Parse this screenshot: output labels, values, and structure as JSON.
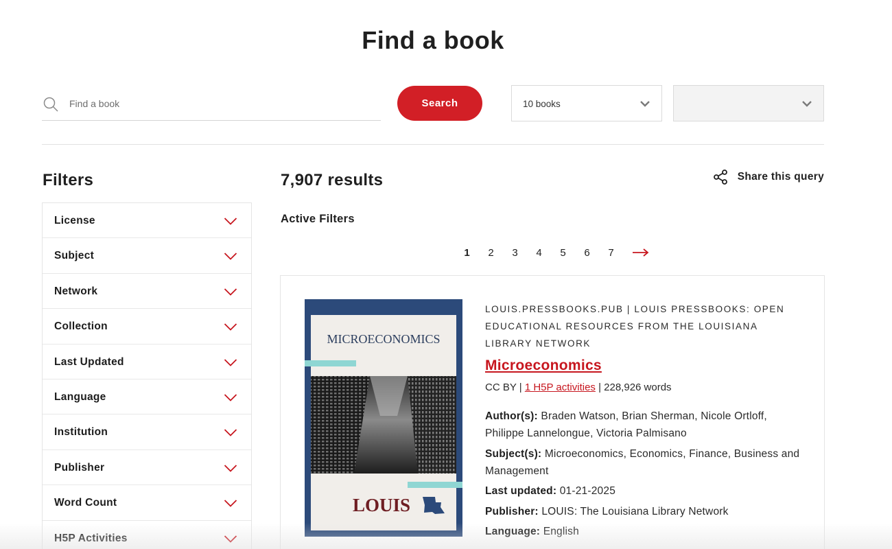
{
  "page": {
    "title": "Find a book"
  },
  "search": {
    "placeholder": "Find a book",
    "value": "",
    "button_label": "Search"
  },
  "selects": {
    "books_per_page": "10 books",
    "sort": ""
  },
  "filters": {
    "title": "Filters",
    "items": [
      {
        "label": "License"
      },
      {
        "label": "Subject"
      },
      {
        "label": "Network"
      },
      {
        "label": "Collection"
      },
      {
        "label": "Last Updated"
      },
      {
        "label": "Language"
      },
      {
        "label": "Institution"
      },
      {
        "label": "Publisher"
      },
      {
        "label": "Word Count"
      },
      {
        "label": "H5P Activities"
      }
    ]
  },
  "results": {
    "count": "7,907 results",
    "share_label": "Share this query",
    "active_filters_label": "Active Filters"
  },
  "pagination": {
    "pages": [
      "1",
      "2",
      "3",
      "4",
      "5",
      "6",
      "7"
    ],
    "current": "1",
    "next_icon": "arrow-right-icon"
  },
  "book": {
    "source": "LOUIS.PRESSBOOKS.PUB | LOUIS PRESSBOOKS: OPEN EDUCATIONAL RESOURCES FROM THE LOUISIANA LIBRARY NETWORK",
    "title": "Microeconomics",
    "license": "CC BY",
    "sep1": " | ",
    "h5p": "1 H5P activities",
    "sep2": " | ",
    "words": "228,926 words",
    "authors_label": "Author(s):",
    "authors": "Braden Watson, Brian Sherman, Nicole Ortloff, Philippe Lannelongue, Victoria Palmisano",
    "subjects_label": "Subject(s):",
    "subjects": "Microeconomics, Economics, Finance, Business and Management",
    "updated_label": "Last updated:",
    "updated": "01-21-2025",
    "publisher_label": "Publisher:",
    "publisher": "LOUIS: The Louisiana Library Network",
    "language_label": "Language:",
    "language": "English",
    "cover": {
      "title": "MICROECONOMICS",
      "logo": "LOUIS"
    }
  },
  "colors": {
    "accent": "#d21f26",
    "cover_border": "#2c4a7a",
    "cover_bg": "#f1eeea",
    "cover_teal": "#8fd6d3"
  }
}
